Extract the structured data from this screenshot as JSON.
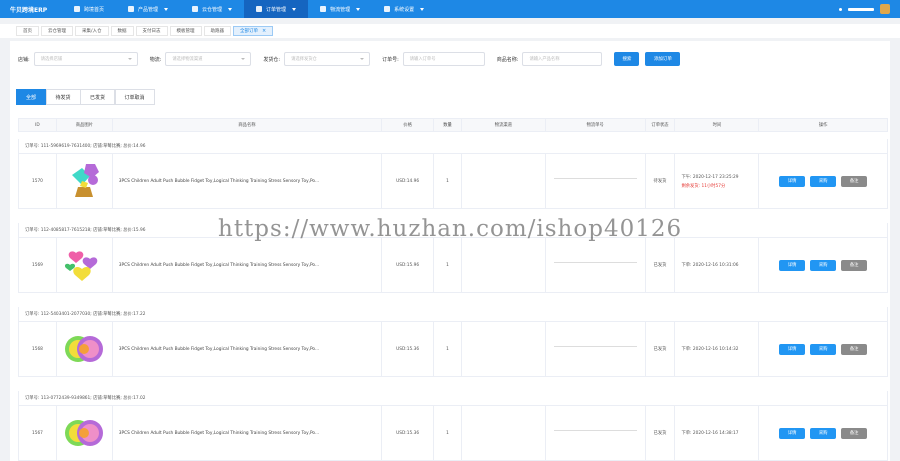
{
  "nav": {
    "brand": "牛贝跨境ERP",
    "items": [
      {
        "label": "跨境首页",
        "icon": "home-icon",
        "caret": false
      },
      {
        "label": "产品管理",
        "icon": "grid-icon",
        "caret": true
      },
      {
        "label": "云仓管理",
        "icon": "cloud-icon",
        "caret": true
      },
      {
        "label": "订单管理",
        "icon": "cart-icon",
        "caret": true
      },
      {
        "label": "物流管理",
        "icon": "truck-icon",
        "caret": true
      },
      {
        "label": "系统设置",
        "icon": "gear-icon",
        "caret": true
      }
    ],
    "active_index": 3
  },
  "tabs": [
    "首页",
    "云仓管理",
    "采集/入仓",
    "数据",
    "支付日志",
    "模板管理",
    "助跑器",
    "全部订单"
  ],
  "active_tab_index": 7,
  "filters": {
    "shop_label": "店铺:",
    "shop_placeholder": "请选择店铺",
    "logistics_label": "物流:",
    "logistics_placeholder": "请选择物流渠道",
    "warehouse_label": "发货仓:",
    "warehouse_placeholder": "请选择发货仓",
    "order_no_label": "订单号:",
    "order_no_placeholder": "请输入订单号",
    "product_name_label": "商品名称:",
    "product_name_placeholder": "请输入产品名称",
    "search_button": "搜索",
    "add_order_button": "添加订单"
  },
  "status_tabs": [
    "全部",
    "待发货",
    "已发货",
    "订单取消"
  ],
  "active_status_index": 0,
  "table": {
    "headers": [
      "ID",
      "商品图片",
      "商品名称",
      "价格",
      "数量",
      "物流渠道",
      "物流单号",
      "订单状态",
      "时间",
      "操作"
    ]
  },
  "orders": [
    {
      "head": "订单号: 111-5969619-7631400; 店铺:草莓比赛; 总价:14.96",
      "id": "1570",
      "title": "3PCS Children Adult Push Bubble Fidget Toy,Logical Thinking Training Stress Sensory Toy,Po...",
      "price": "USD:14.96",
      "qty": "1",
      "status": "待发货",
      "time_line1": "下午: 2020-12-17 23:25:29",
      "time_line2": "剩余发货: 11小时57分",
      "thumb": "mixed-shapes"
    },
    {
      "head": "订单号: 112-4085817-7615218; 店铺:草莓比赛; 总价:15.96",
      "id": "1569",
      "title": "3PCS Children Adult Push Bubble Fidget Toy,Logical Thinking Training Stress Sensory Toy,Po...",
      "price": "USD:15.96",
      "qty": "1",
      "status": "已发货",
      "time_line1": "下单: 2020-12-16 10:31:06",
      "time_line2": "",
      "thumb": "hearts"
    },
    {
      "head": "订单号: 112-5403401-2077030; 店铺:草莓比赛; 总价:17.22",
      "id": "1568",
      "title": "3PCS Children Adult Push Bubble Fidget Toy,Logical Thinking Training Stress Sensory Toy,Po...",
      "price": "USD:15.36",
      "qty": "1",
      "status": "已发货",
      "time_line1": "下单: 2020-12-16 10:14:32",
      "time_line2": "",
      "thumb": "rainbow"
    },
    {
      "head": "订单号: 113-0772439-9349861; 店铺:草莓比赛; 总价:17.02",
      "id": "1567",
      "title": "3PCS Children Adult Push Bubble Fidget Toy,Logical Thinking Training Stress Sensory Toy,Po...",
      "price": "USD:15.36",
      "qty": "1",
      "status": "已发货",
      "time_line1": "下单: 2020-12-16 14:38:17",
      "time_line2": "",
      "thumb": "rainbow"
    }
  ],
  "row_buttons": {
    "detail": "详情",
    "purchase": "采购",
    "note": "备注"
  },
  "colors": {
    "primary": "#1e88e5",
    "warning": "#e53935",
    "gray_button": "#8a8a8a"
  },
  "watermark": "https://www.huzhan.com/ishop40126"
}
